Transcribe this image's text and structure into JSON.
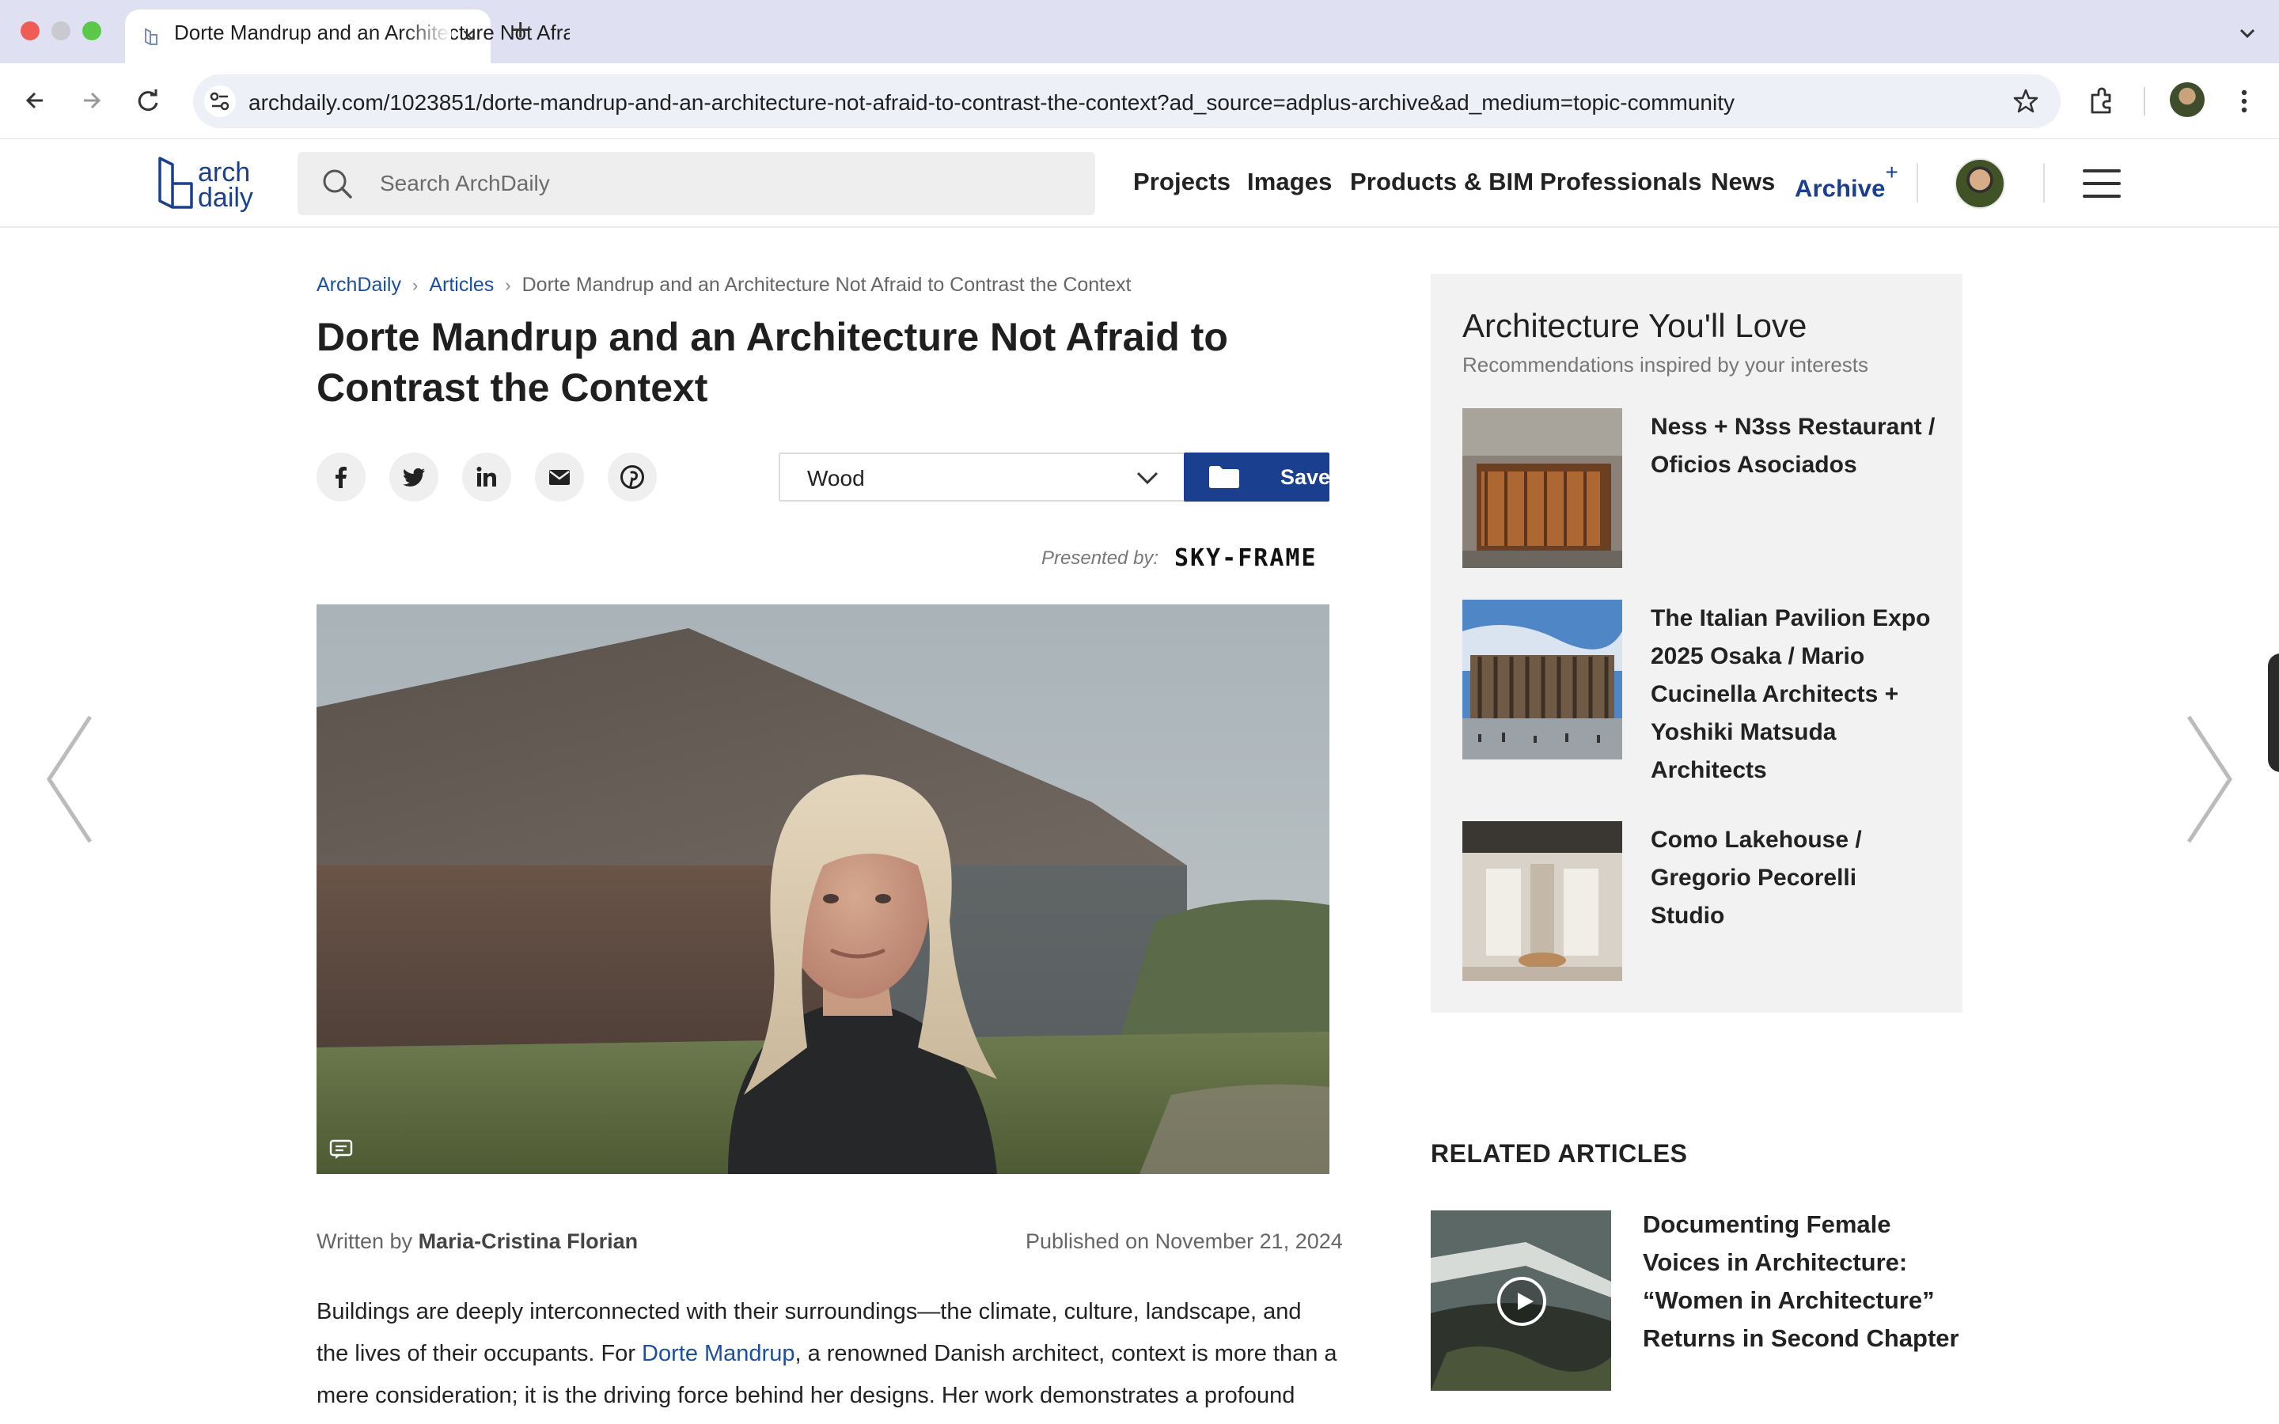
{
  "browser": {
    "tab_title": "Dorte Mandrup and an Architecture Not Afraid to Contrast the Context",
    "new_tab_symbol": "+",
    "close_symbol": "×",
    "url": "archdaily.com/1023851/dorte-mandrup-and-an-architecture-not-afraid-to-contrast-the-context?ad_source=adplus-archive&ad_medium=topic-community"
  },
  "header": {
    "logo_text_line1": "arch",
    "logo_text_line2": "daily",
    "search_placeholder": "Search ArchDaily",
    "nav": [
      "Projects",
      "Images",
      "Products & BIM",
      "Professionals",
      "News"
    ],
    "archive_label": "Archive",
    "archive_plus": "+",
    "brand_color": "#1b3f8f"
  },
  "article": {
    "breadcrumb": [
      "ArchDaily",
      "Articles",
      "Dorte Mandrup and an Architecture Not Afraid to Contrast the Context"
    ],
    "breadcrumb_sep": "›",
    "title": "Dorte Mandrup and an Architecture Not Afraid to Contrast the Context",
    "share_icons": [
      "facebook-icon",
      "twitter-icon",
      "linkedin-icon",
      "email-icon",
      "pinterest-icon"
    ],
    "folder_value": "Wood",
    "save_label": "Save",
    "presented_by": "Presented by:",
    "sponsor": "SKY-FRAME",
    "written_by_label": "Written by",
    "author": "Maria-Cristina Florian",
    "published": "Published on November 21, 2024",
    "body_part1": "Buildings are deeply interconnected with their surroundings—the climate, culture, landscape, and the lives of their occupants. For ",
    "body_link": "Dorte Mandrup",
    "body_part2": ", a renowned Danish architect, context is more than a mere consideration; it is the driving force behind her designs. Her work demonstrates a profound curiosity"
  },
  "sidebar": {
    "title": "Architecture You'll Love",
    "subtitle": "Recommendations inspired by your interests",
    "items": [
      {
        "title": "Ness + N3ss Restaurant / Oficios Asociados"
      },
      {
        "title": "The Italian Pavilion Expo 2025 Osaka / Mario Cucinella Architects + Yoshiki Matsuda Architects"
      },
      {
        "title": "Como Lakehouse / Gregorio Pecorelli Studio"
      }
    ]
  },
  "related": {
    "heading": "RELATED ARTICLES",
    "items": [
      {
        "title": "Documenting Female Voices in Architecture: “Women in Architecture” Returns in Second Chapter"
      }
    ]
  }
}
